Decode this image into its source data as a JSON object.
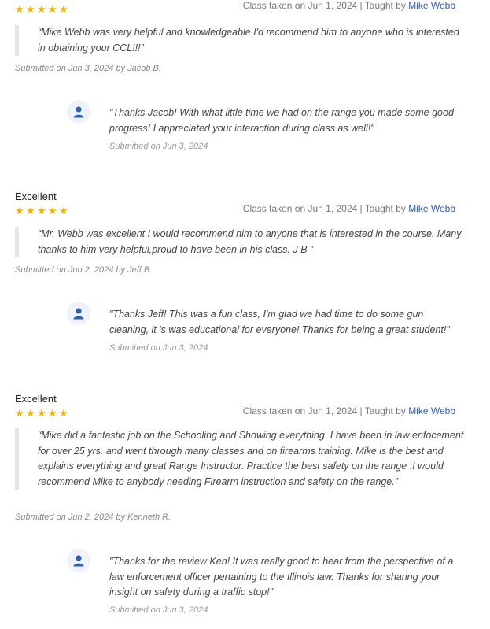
{
  "reviews": [
    {
      "title": "",
      "stars": 5,
      "class_taken_label": "Class taken on Jun 1, 2024",
      "taught_by_label": "Taught by",
      "teacher": "Mike Webb",
      "quote": "“Mike Webb was very helpful and knowledgeable I'd recommend him to anyone who is interested in obtaining your CCL!!!”",
      "submitted": "Submitted on Jun 3, 2024 by Jacob B.",
      "reply": {
        "text": "\"Thanks Jacob! With what little time we had on the range you made some good progress! I appreciated your interaction during class as well!\"",
        "submitted": "Submitted on Jun 3, 2024"
      }
    },
    {
      "title": "Excellent",
      "stars": 5,
      "class_taken_label": "Class taken on Jun 1, 2024",
      "taught_by_label": "Taught by",
      "teacher": "Mike Webb",
      "quote": "“Mr. Webb was excellent I would recommend him to anyone that is interested in the course. Many thanks to him very helpful,proud to have been in his class. J B ”",
      "submitted": "Submitted on Jun 2, 2024 by Jeff B.",
      "reply": {
        "text": "\"Thanks Jeff! This was a fun class, I'm glad we had time to do some gun cleaning, it 's was educational for everyone! Thanks for being a great student!\"",
        "submitted": "Submitted on Jun 3, 2024"
      }
    },
    {
      "title": "Excellent",
      "stars": 5,
      "class_taken_label": "Class taken on Jun 1, 2024",
      "taught_by_label": "Taught by",
      "teacher": "Mike Webb",
      "quote": "“Mike did a fantastic job on the Schooling and Showing everything. I have been in law enfocement for over 25 yrs. and went through many classes and on firearms training. Mike is the best and explains everything and great Range Instructor. Practice the best safety on the range .I would recommend Mike to anybody needing Firearm instruction and safety on the range.”",
      "submitted": "Submitted on Jun 2, 2024 by Kenneth R.",
      "reply": {
        "text": "\"Thanks for the review Ken! It was really good to hear from the perspective of a law enforcement officer pertaining to the Illinois law. Thanks for sharing your insight on safety during a traffic stop!\"",
        "submitted": "Submitted on Jun 3, 2024"
      }
    }
  ],
  "colors": {
    "star": "#f0b400",
    "teacher_link": "#2f5fa8",
    "avatar": "#2f5fa8"
  },
  "icons": {
    "star": "star-icon",
    "avatar": "user-avatar-icon"
  }
}
